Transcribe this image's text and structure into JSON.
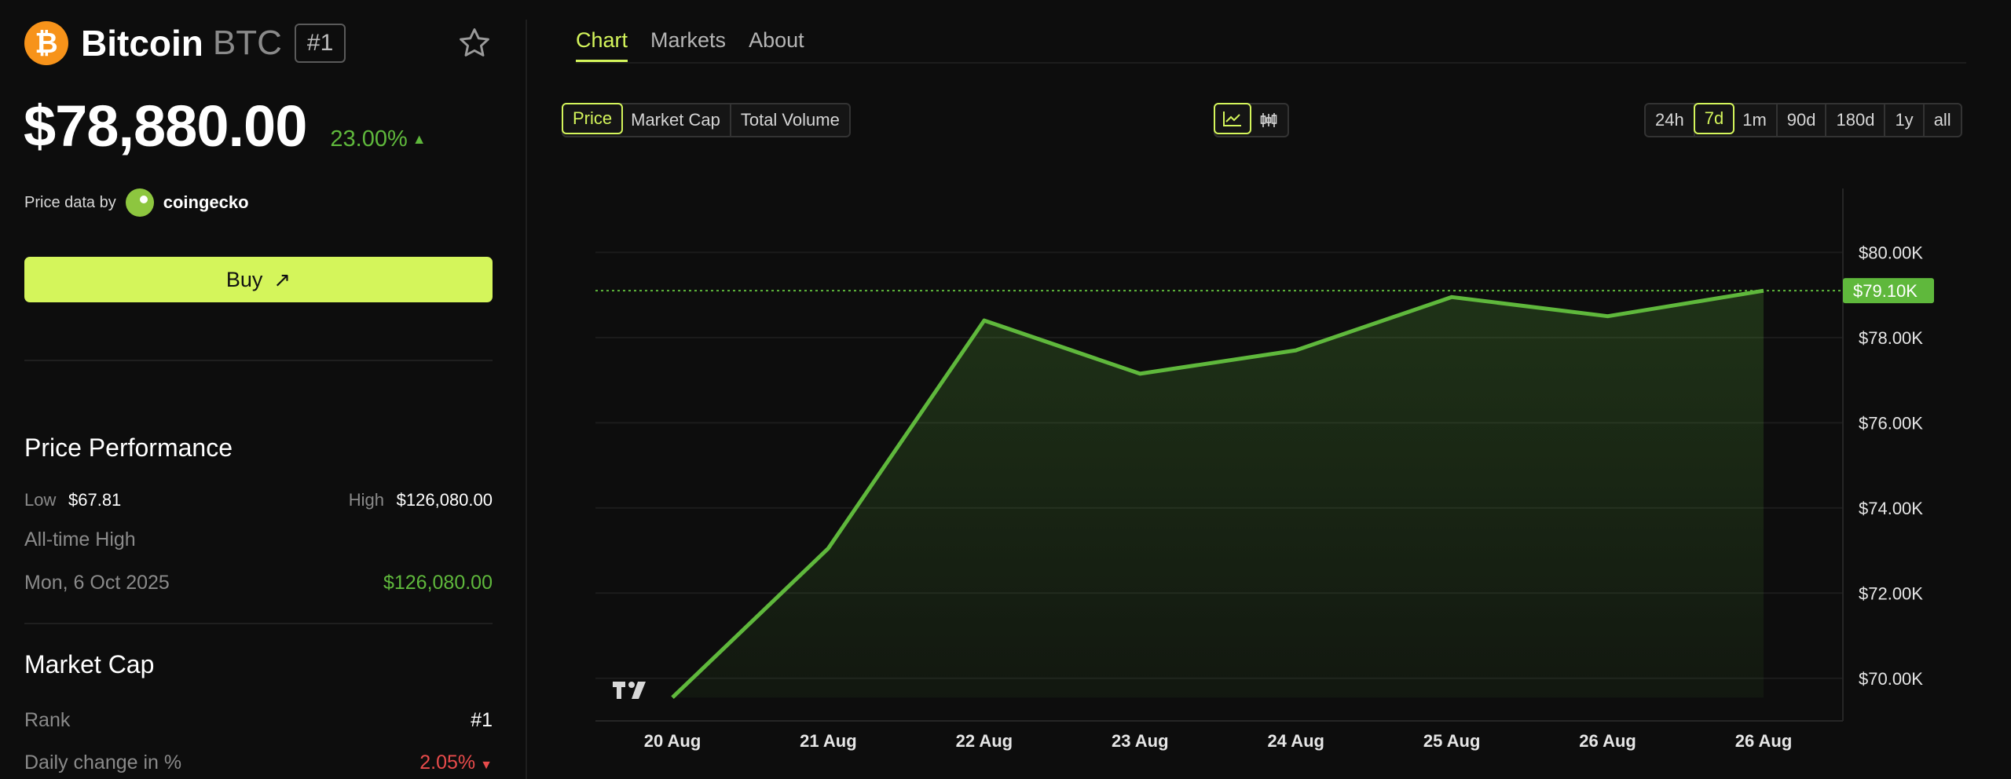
{
  "coin": {
    "logo_glyph": "₿",
    "name": "Bitcoin",
    "symbol": "BTC",
    "rank_badge": "#1",
    "price": "$78,880.00",
    "change": "23.00%",
    "change_arrow": "▲",
    "price_data_label": "Price data by",
    "provider": "coingecko",
    "buy_label": "Buy",
    "buy_arrow": "↗"
  },
  "performance": {
    "title": "Price Performance",
    "low_label": "Low",
    "low_value": "$67.81",
    "high_label": "High",
    "high_value": "$126,080.00",
    "ath_label": "All-time High",
    "ath_date": "Mon, 6 Oct 2025",
    "ath_value": "$126,080.00"
  },
  "market_cap": {
    "title": "Market Cap",
    "rank_label": "Rank",
    "rank_value": "#1",
    "daily_label": "Daily change in %",
    "daily_value": "2.05%",
    "daily_arrow": "▼"
  },
  "tabs": [
    {
      "label": "Chart",
      "active": true
    },
    {
      "label": "Markets",
      "active": false
    },
    {
      "label": "About",
      "active": false
    }
  ],
  "metric_options": [
    {
      "label": "Price",
      "active": true
    },
    {
      "label": "Market Cap",
      "active": false
    },
    {
      "label": "Total Volume",
      "active": false
    }
  ],
  "chart_type_options": [
    {
      "icon": "line-chart-icon",
      "active": true
    },
    {
      "icon": "candlestick-icon",
      "active": false
    }
  ],
  "range_options": [
    {
      "label": "24h",
      "active": false
    },
    {
      "label": "7d",
      "active": true
    },
    {
      "label": "1m",
      "active": false
    },
    {
      "label": "90d",
      "active": false
    },
    {
      "label": "180d",
      "active": false
    },
    {
      "label": "1y",
      "active": false
    },
    {
      "label": "all",
      "active": false
    }
  ],
  "colors": {
    "accent": "#d4f55b",
    "line": "#5fb83c",
    "negative": "#e84b4b"
  },
  "chart_data": {
    "type": "area",
    "x": [
      "20 Aug",
      "21 Aug",
      "22 Aug",
      "23 Aug",
      "24 Aug",
      "25 Aug",
      "26 Aug",
      "26 Aug"
    ],
    "values": [
      69550,
      73050,
      78400,
      77150,
      77700,
      78950,
      78500,
      79100
    ],
    "ylim": [
      69000,
      81500
    ],
    "y_ticks": [
      70000,
      72000,
      74000,
      76000,
      78000,
      80000
    ],
    "y_tick_labels": [
      "$70.00K",
      "$72.00K",
      "$74.00K",
      "$76.00K",
      "$78.00K",
      "$80.00K"
    ],
    "last_price_label": "$79.10K",
    "last_price_value": 79100,
    "grid": true,
    "watermark": "TV"
  }
}
